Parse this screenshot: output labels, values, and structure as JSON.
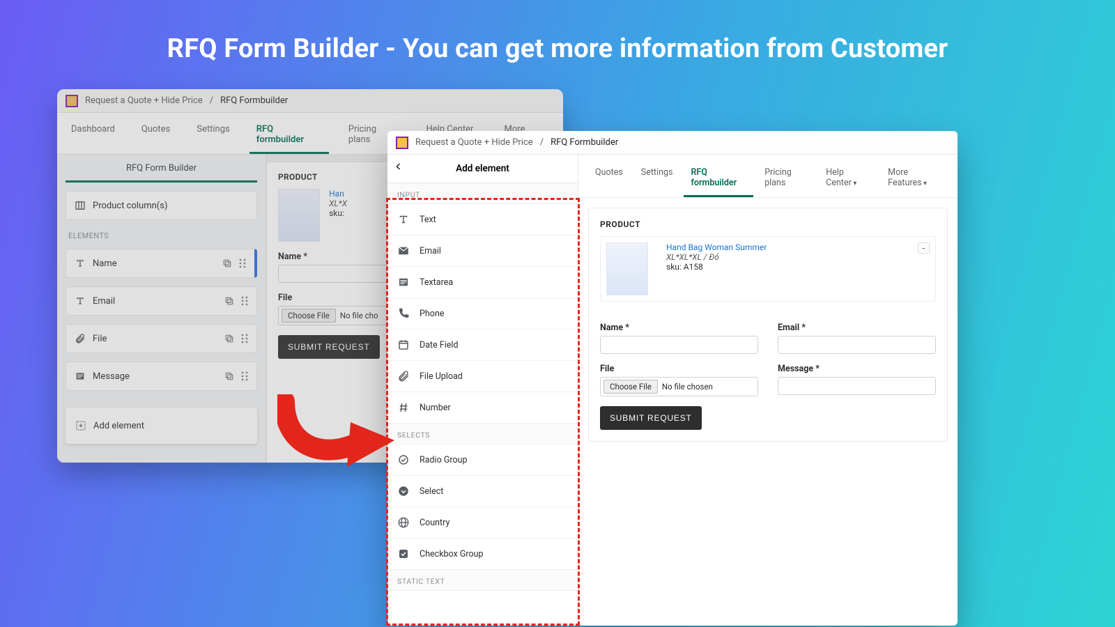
{
  "headline": "RFQ Form Builder - You can get more information from Customer",
  "left": {
    "breadcrumb_app": "Request a Quote + Hide Price",
    "breadcrumb_sep": " / ",
    "breadcrumb_here": "RFQ Formbuilder",
    "tabs": {
      "dashboard": "Dashboard",
      "quotes": "Quotes",
      "settings": "Settings",
      "rfq": "RFQ formbuilder",
      "pricing": "Pricing plans",
      "help": "Help Center",
      "more": "More Featu"
    },
    "sidebar_title": "RFQ Form Builder",
    "product_columns": "Product column(s)",
    "elements_label": "ELEMENTS",
    "items": {
      "name": "Name",
      "email": "Email",
      "file": "File",
      "message": "Message"
    },
    "add_element": "Add element",
    "preview": {
      "heading": "PRODUCT",
      "prod_name": "Han",
      "variant": "XL*X",
      "sku_label": "sku:",
      "name_label": "Name *",
      "file_label": "File",
      "choose_file": "Choose File",
      "no_file": "No file cho",
      "submit": "SUBMIT REQUEST"
    }
  },
  "right": {
    "breadcrumb_app": "Request a Quote + Hide Price",
    "breadcrumb_sep": " / ",
    "breadcrumb_here": "RFQ Formbuilder",
    "addcol_title": "Add element",
    "group_input": "INPUT",
    "group_selects": "SELECTS",
    "group_static": "STATIC TEXT",
    "opts": {
      "text": "Text",
      "email": "Email",
      "textarea": "Textarea",
      "phone": "Phone",
      "date": "Date Field",
      "file": "File Upload",
      "number": "Number",
      "radio": "Radio Group",
      "select": "Select",
      "country": "Country",
      "checkbox": "Checkbox Group"
    },
    "tabs": {
      "quotes": "Quotes",
      "settings": "Settings",
      "rfq": "RFQ formbuilder",
      "pricing": "Pricing plans",
      "help": "Help Center",
      "more": "More Features"
    },
    "preview": {
      "heading": "PRODUCT",
      "prod_name": "Hand Bag Woman Summer",
      "variant": "XL*XL*XL / Đỏ",
      "sku": "sku: A158",
      "name_label": "Name *",
      "email_label": "Email *",
      "file_label": "File",
      "message_label": "Message *",
      "choose_file": "Choose File",
      "no_file": "No file chosen",
      "submit": "SUBMIT REQUEST",
      "remove": "-"
    }
  }
}
